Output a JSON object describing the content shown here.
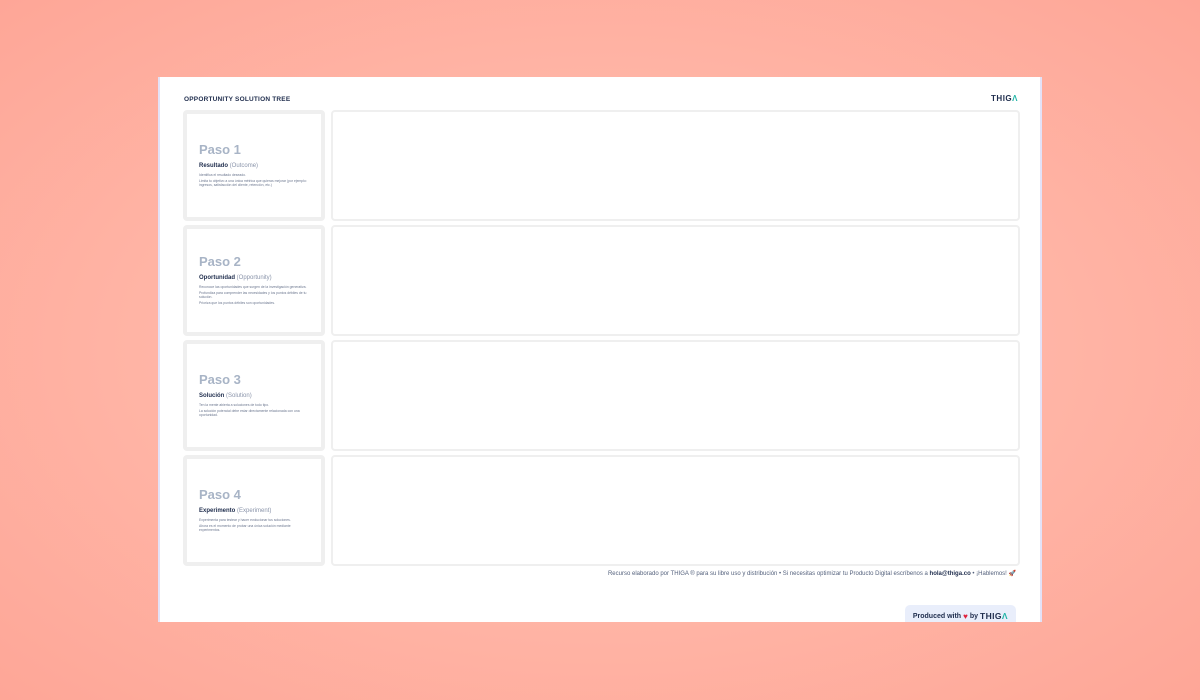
{
  "board": {
    "title": "OPPORTUNITY SOLUTION TREE",
    "logo_main": "THIG",
    "logo_accent": "Λ"
  },
  "steps": [
    {
      "title": "Paso 1",
      "name": "Resultado",
      "en": "(Outcome)",
      "desc": [
        "Identifica el resultado deseado.",
        "Limita tu objetivo a una única métrica que quieras mejorar (por ejemplo: ingresos, satisfacción del cliente, retención, etc.)"
      ]
    },
    {
      "title": "Paso 2",
      "name": "Oportunidad",
      "en": "(Opportunity)",
      "desc": [
        "Reconoce las oportunidades que surgen de la investigación generativa.",
        "Profundiza para comprender las necesidades y los puntos débiles de tu solución.",
        "Prioriza que los puntos débiles son oportunidades."
      ]
    },
    {
      "title": "Paso 3",
      "name": "Solución",
      "en": "(Solution)",
      "desc": [
        "Ten la mente abierta a soluciones de todo tipo.",
        "La solución potencial debe estar directamente relacionada con una oportunidad."
      ]
    },
    {
      "title": "Paso 4",
      "name": "Experimento",
      "en": "(Experiment)",
      "desc": [
        "Experimenta para testear y hacer evolucionar tus soluciones.",
        "Ahora es el momento de probar una única solución mediante experimentos."
      ]
    }
  ],
  "footer": {
    "note_pre": "Recurso elaborado por THIGA ® para su libre uso y distribución  •  Si necesitas optimizar tu Producto Digital escríbenos a ",
    "email": "hola@thiga.co",
    "note_post": "  •  ¡Hablemos! ",
    "rocket": "🚀"
  },
  "produced": {
    "pre": "Produced with",
    "heart": "♥",
    "by": "by",
    "brand_main": "THIG",
    "brand_accent": "Λ"
  }
}
